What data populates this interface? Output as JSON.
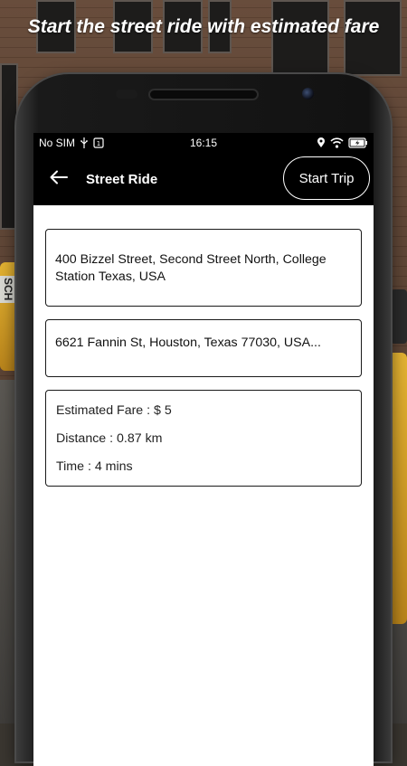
{
  "headline": "Start the street ride with estimated fare",
  "status_bar": {
    "carrier": "No SIM",
    "time": "16:15",
    "icons": [
      "usb-icon",
      "sim-icon",
      "location-icon",
      "wifi-icon",
      "battery-charging-icon"
    ]
  },
  "app_bar": {
    "title": "Street Ride",
    "start_trip_label": "Start Trip",
    "back_icon": "arrow-left-icon"
  },
  "pickup_address": "400 Bizzel Street, Second Street North, College Station Texas, USA",
  "dropoff_address": "6621 Fannin St, Houston, Texas 77030, USA...",
  "trip_info": {
    "fare": "Estimated Fare : $ 5",
    "distance": "Distance : 0.87 km",
    "time": "Time : 4 mins"
  },
  "colors": {
    "app_bar_bg": "#000000",
    "content_bg": "#ffffff",
    "text": "#111111"
  }
}
